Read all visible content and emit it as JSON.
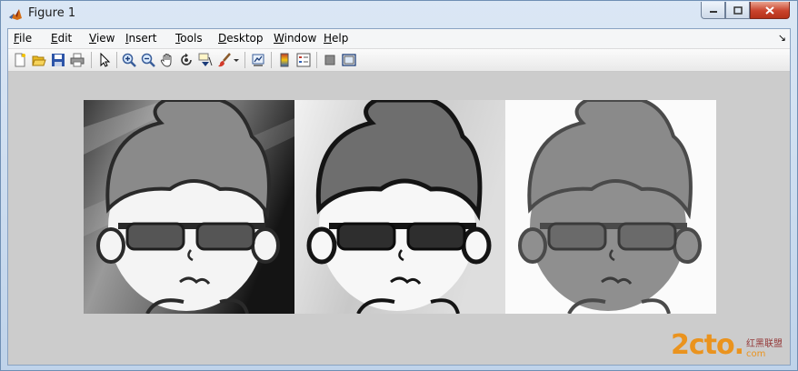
{
  "window": {
    "title": "Figure 1"
  },
  "menubar": {
    "items": [
      {
        "label": "File",
        "mnemonic": "F",
        "rest": "ile"
      },
      {
        "label": "Edit",
        "mnemonic": "E",
        "rest": "dit"
      },
      {
        "label": "View",
        "mnemonic": "V",
        "rest": "iew"
      },
      {
        "label": "Insert",
        "mnemonic": "I",
        "rest": "nsert"
      },
      {
        "label": "Tools",
        "mnemonic": "T",
        "rest": "ools"
      },
      {
        "label": "Desktop",
        "mnemonic": "D",
        "rest": "esktop"
      },
      {
        "label": "Window",
        "mnemonic": "W",
        "rest": "indow"
      },
      {
        "label": "Help",
        "mnemonic": "H",
        "rest": "elp"
      }
    ],
    "dock_arrow": "↘"
  },
  "toolbar": {
    "icons": [
      "new-figure-icon",
      "open-file-icon",
      "save-icon",
      "print-icon",
      "edit-plot-arrow-icon",
      "zoom-in-icon",
      "zoom-out-icon",
      "pan-hand-icon",
      "rotate-3d-icon",
      "data-cursor-icon",
      "brush-icon",
      "brush-dropdown-icon",
      "link-plot-icon",
      "insert-colorbar-icon",
      "insert-legend-icon",
      "hide-plot-tools-icon",
      "show-plot-tools-icon"
    ]
  },
  "figure": {
    "panels": [
      "original-grayscale",
      "histogram-equalized",
      "edge-filtered"
    ]
  },
  "watermark": {
    "main": "2cto",
    "dot": ".",
    "com": "com",
    "sub": "红黑联盟"
  },
  "colors": {
    "canvas": "#cccccc",
    "close_button": "#c9432c",
    "watermark": "#f08a00"
  }
}
